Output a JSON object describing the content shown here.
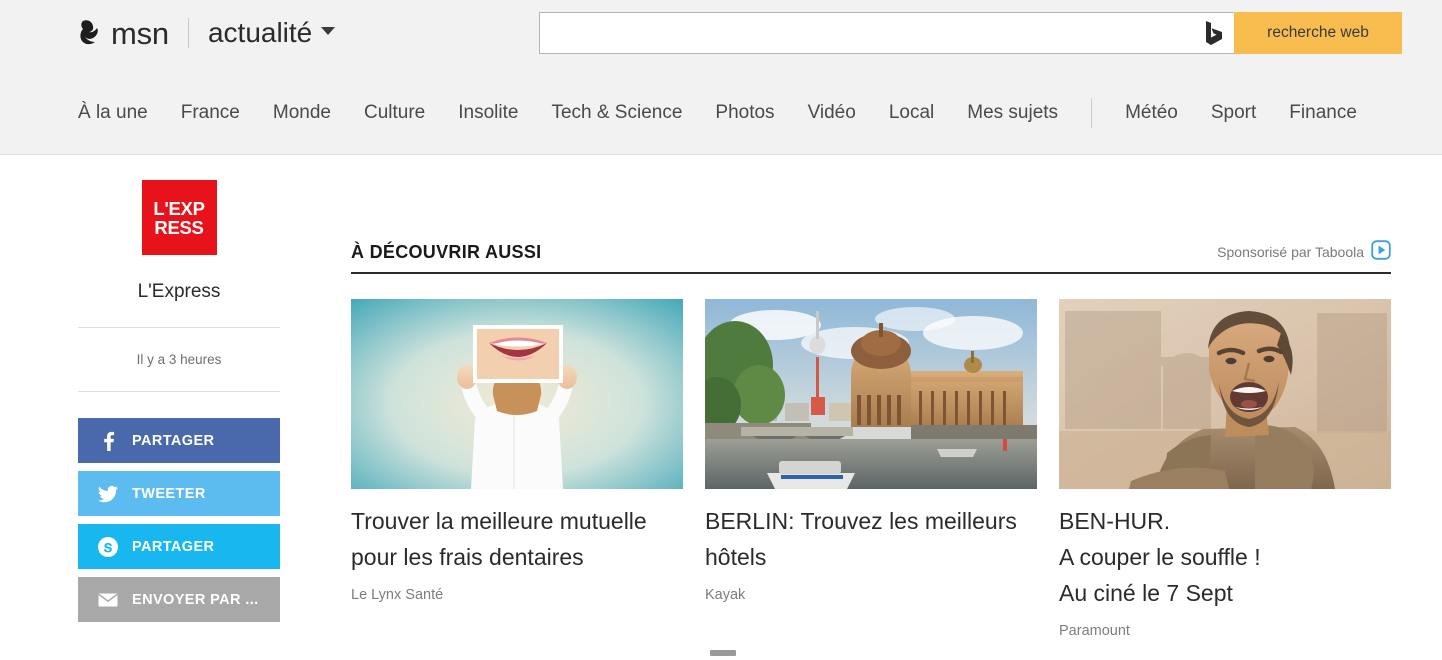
{
  "header": {
    "brand_name": "msn",
    "brand_icon": "msn-butterfly-icon",
    "vertical_label": "actualité",
    "vertical_caret_icon": "chevron-down-icon",
    "search": {
      "value": "",
      "placeholder": "",
      "engine_icon": "bing-icon",
      "button_label": "recherche web",
      "button_color": "#f9bc4f"
    },
    "nav_items": [
      {
        "label": "À la une",
        "type": "link"
      },
      {
        "label": "France",
        "type": "link"
      },
      {
        "label": "Monde",
        "type": "link"
      },
      {
        "label": "Culture",
        "type": "link"
      },
      {
        "label": "Insolite",
        "type": "link"
      },
      {
        "label": "Tech & Science",
        "type": "link"
      },
      {
        "label": "Photos",
        "type": "link"
      },
      {
        "label": "Vidéo",
        "type": "link"
      },
      {
        "label": "Local",
        "type": "link"
      },
      {
        "label": "Mes sujets",
        "type": "link"
      },
      {
        "label": "",
        "type": "divider"
      },
      {
        "label": "Météo",
        "type": "link"
      },
      {
        "label": "Sport",
        "type": "link"
      },
      {
        "label": "Finance",
        "type": "link"
      }
    ]
  },
  "sidebar": {
    "source_logo_lines": [
      "L'EXP",
      "RESS"
    ],
    "source_logo_color": "#e8121a",
    "source_name": "L'Express",
    "time_ago": "Il y a 3 heures",
    "share_buttons": [
      {
        "label": "PARTAGER",
        "icon": "facebook-icon",
        "color": "#4a69ad",
        "cls": "fb"
      },
      {
        "label": "TWEETER",
        "icon": "twitter-icon",
        "color": "#5cbcf0",
        "cls": "tw"
      },
      {
        "label": "PARTAGER",
        "icon": "skype-icon",
        "color": "#18b7f0",
        "cls": "sk"
      },
      {
        "label": "ENVOYER PAR ...",
        "icon": "envelope-icon",
        "color": "#a8a8a8",
        "cls": "ml"
      }
    ]
  },
  "main": {
    "section_title": "À DÉCOUVRIR AUSSI",
    "sponsor_label": "Sponsorisé par Taboola",
    "sponsor_icon": "taboola-play-icon",
    "cards": [
      {
        "title": "Trouver la meilleure mutuelle pour les frais dentaires",
        "source": "Le Lynx Santé",
        "image_alt": "woman-holding-smile-photo"
      },
      {
        "title": "BERLIN: Trouvez les meilleurs hôtels",
        "source": "Kayak",
        "image_alt": "berlin-bode-museum-river"
      },
      {
        "title": "BEN-HUR.\nA couper le souffle !\nAu ciné le 7 Sept",
        "source": "Paramount",
        "image_alt": "ben-hur-shouting-man-arena"
      }
    ]
  }
}
